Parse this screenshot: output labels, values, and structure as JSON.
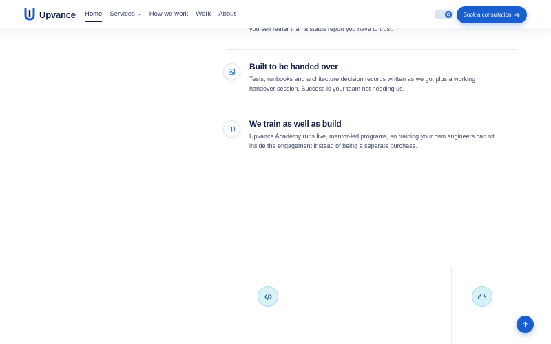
{
  "header": {
    "brand": "Upvance",
    "nav": [
      {
        "label": "Home",
        "active": true
      },
      {
        "label": "Services",
        "active": false,
        "has_dropdown": true
      },
      {
        "label": "How we work",
        "active": false
      },
      {
        "label": "Work",
        "active": false
      },
      {
        "label": "About",
        "active": false
      }
    ],
    "cta_label": "Book a consultation",
    "cta_icon": "arrow-right-icon",
    "theme_toggle_icon": "theme-toggle-icon"
  },
  "content": {
    "partial_text": "yourself rather than a status report you have to trust.",
    "features": [
      {
        "icon": "handover-icon",
        "title": "Built to be handed over",
        "description": "Tests, runbooks and architecture decision records written as we go, plus a working handover session. Success is your team not needing us."
      },
      {
        "icon": "book-icon",
        "title": "We train as well as build",
        "description": "Upvance Academy runs live, mentor-led programs, so training your own engineers can sit inside the engagement instead of being a separate purchase."
      }
    ]
  },
  "lower": {
    "icons": [
      "code-icon",
      "cloud-icon"
    ],
    "scroll_top_icon": "arrow-up-icon"
  },
  "colors": {
    "primary": "#1a5fcf",
    "heading": "#17204a",
    "body_text": "#414a63",
    "bubble_bg": "#d7f1f7"
  }
}
